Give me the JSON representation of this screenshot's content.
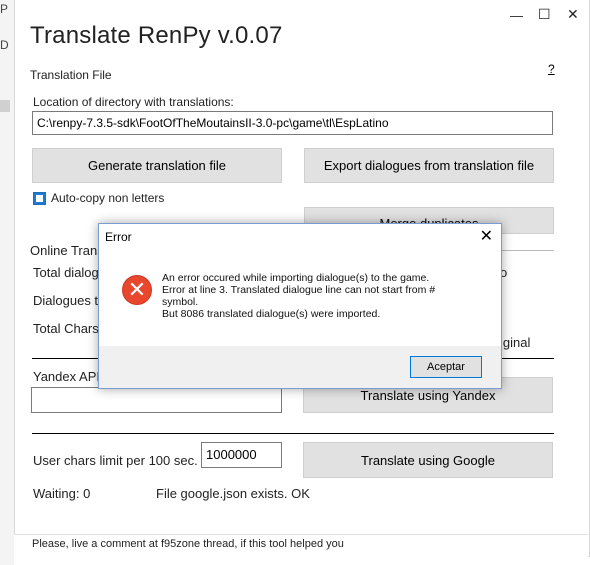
{
  "window": {
    "title": "Translate RenPy  v.0.07",
    "help": "?",
    "controls": {
      "minimize": "—",
      "maximize": "☐",
      "close": "✕"
    }
  },
  "translation_file": {
    "group_label": "Translation File",
    "location_label": "Location of directory with translations:",
    "location_value": "C:\\renpy-7.3.5-sdk\\FootOfTheMoutainsII-3.0-pc\\game\\tl\\EspLatino",
    "generate_button": "Generate translation file",
    "export_button": "Export dialogues from translation file",
    "auto_copy_label": "Auto-copy non letters",
    "merge_button": "Merge duplicates"
  },
  "online": {
    "group_label": "Online Trans",
    "total_dialogues": "Total dialog",
    "dialogues_t": "Dialogues t",
    "total_chars": "Total Chars:",
    "right_fragment_1": "o",
    "right_fragment_2": "iginal",
    "yandex_label": "Yandex API",
    "yandex_value": "",
    "yandex_button": "Translate using Yandex",
    "chars_limit_label": "User chars limit per 100 sec.",
    "chars_limit_value": "1000000",
    "google_button": "Translate using Google",
    "waiting": "Waiting: 0",
    "google_status": "File google.json exists. OK"
  },
  "status_bar": "Please, live a comment at f95zone thread, if this tool helped you",
  "dialog": {
    "title": "Error",
    "close": "✕",
    "message_line1": "An error occured while importing dialogue(s) to the game.",
    "message_line2": "Error at line 3. Translated dialogue line can not start from #",
    "message_line3": "symbol.",
    "message_line4": "But 8086 translated dialogue(s) were imported.",
    "ok_button": "Aceptar"
  }
}
